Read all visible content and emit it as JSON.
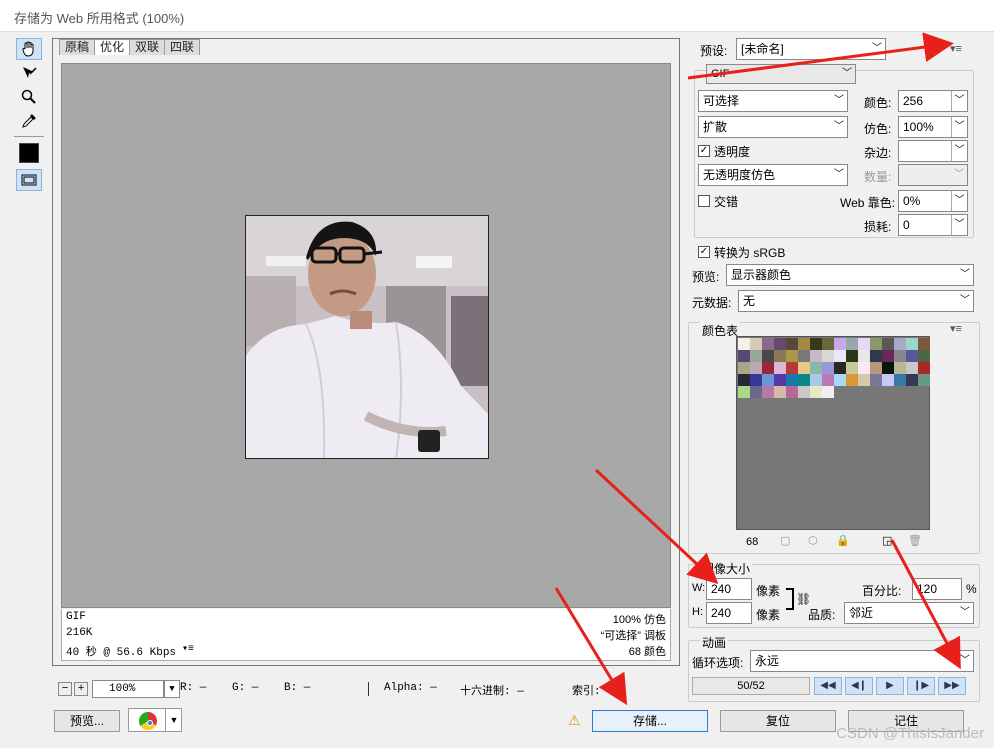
{
  "window": {
    "title": "存储为 Web 所用格式 (100%)"
  },
  "tools": [
    "hand-tool",
    "slice-select-tool",
    "zoom-tool",
    "eyedropper-tool"
  ],
  "tabs": [
    "原稿",
    "优化",
    "双联",
    "四联"
  ],
  "active_tab": "优化",
  "preview_info": {
    "left": [
      "GIF",
      "216K",
      "40 秒 @ 56.6 Kbps"
    ],
    "right": [
      "100% 仿色",
      "“可选择” 调板",
      "68 颜色"
    ],
    "menu": "▾≡"
  },
  "status": {
    "minus": "−",
    "plus": "+",
    "zoom": "100%",
    "r": "R: —",
    "g": "G: —",
    "b": "B: —",
    "alpha": "Alpha: —",
    "hex": "十六进制: —",
    "index": "索引: —"
  },
  "bottom_buttons": {
    "preview": "预览...",
    "save": "存储...",
    "reset": "复位",
    "remember": "记住"
  },
  "settings": {
    "preset_label": "预设:",
    "preset_value": "[未命名]",
    "format": "GIF",
    "reduction": "可选择",
    "dither_algo": "扩散",
    "transparency_label": "透明度",
    "transparency_dither": "无透明度仿色",
    "interlaced_label": "交错",
    "colors_label": "颜色:",
    "colors_value": "256",
    "dither_label": "仿色:",
    "dither_value": "100%",
    "matte_label": "杂边:",
    "amount_label": "数量:",
    "websnap_label": "Web 靠色:",
    "websnap_value": "0%",
    "lossy_label": "损耗:",
    "lossy_value": "0",
    "convert_srgb": "转换为 sRGB",
    "preview_label": "预览:",
    "preview_value": "显示器颜色",
    "metadata_label": "元数据:",
    "metadata_value": "无"
  },
  "color_table": {
    "title": "颜色表",
    "count": "68",
    "colors": [
      "#f4f0e4",
      "#d8c8b8",
      "#8a6a8a",
      "#6a4a6a",
      "#584838",
      "#a88848",
      "#383818",
      "#686838",
      "#c8a8e8",
      "#98a8a8",
      "#e8d8f8",
      "#889868",
      "#585858",
      "#a8a8c8",
      "#98d8c8",
      "#7a5a3a",
      "#584878",
      "#98a898",
      "#484848",
      "#887858",
      "#a89848",
      "#787878",
      "#c8b8c8",
      "#d8d8d8",
      "#e8e8f8",
      "#283818",
      "#e8e8e8",
      "#303850",
      "#6a2858",
      "#888888",
      "#585898",
      "#486848",
      "#a8a888",
      "#b8a8b8",
      "#982838",
      "#d8b8d8",
      "#b83838",
      "#e8c888",
      "#88b8a8",
      "#9898d8",
      "#282828",
      "#c8c898",
      "#f8e8f8",
      "#b89878",
      "#081808",
      "#b8b898",
      "#c8c8c8",
      "#a82828",
      "#282838",
      "#383898",
      "#6898d8",
      "#5838a8",
      "#1878a8",
      "#088888",
      "#a8c8e8",
      "#b878b8",
      "#a8d8f8",
      "#d89838",
      "#d8c8a8",
      "#787898",
      "#c8c8f8",
      "#3878a8",
      "#383858",
      "#689888",
      "#a8d888",
      "#686888",
      "#b878a8",
      "#d8b8a8"
    ],
    "extra": [
      "#b86898",
      "#c8c8c8",
      "#e8e8c8",
      "#f0f0f0"
    ]
  },
  "image_size": {
    "title": "图像大小",
    "w_label": "W:",
    "w_value": "240",
    "h_label": "H:",
    "h_value": "240",
    "unit": "像素",
    "percent_label": "百分比:",
    "percent_value": "120",
    "percent_unit": "%",
    "quality_label": "品质:",
    "quality_value": "邻近"
  },
  "animation": {
    "title": "动画",
    "loop_label": "循环选项:",
    "loop_value": "永远",
    "frame": "50/52",
    "controls": [
      "◀◀",
      "◀❙",
      "▶",
      "❙▶",
      "▶▶"
    ]
  },
  "watermark": "CSDN @ThisIsJander"
}
